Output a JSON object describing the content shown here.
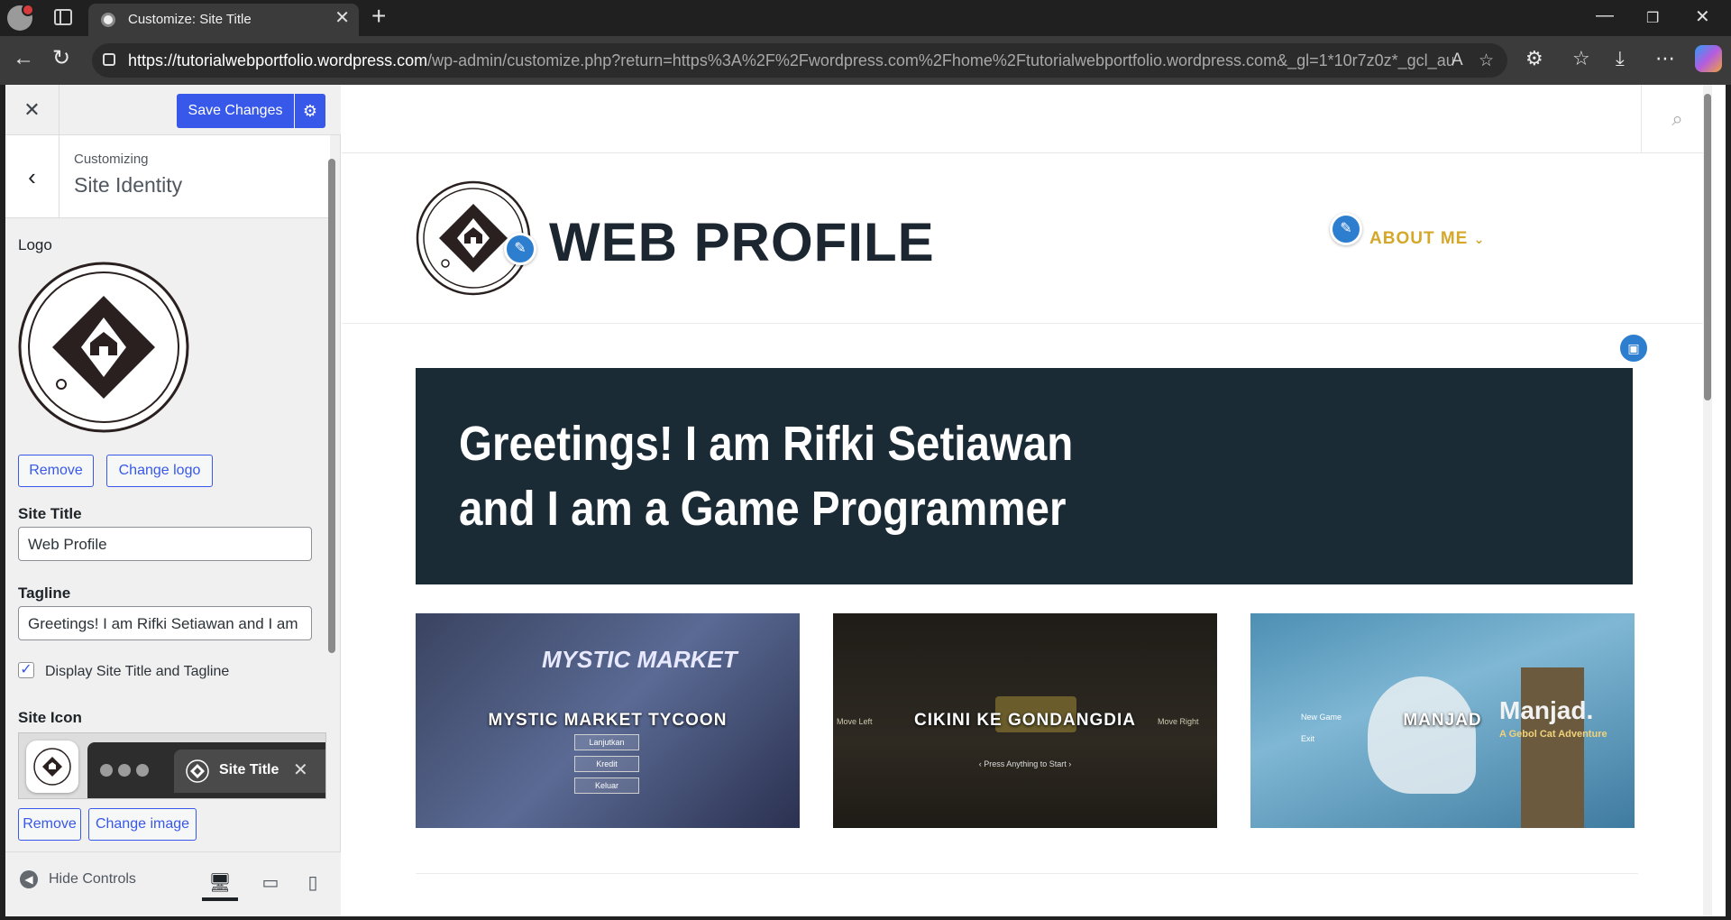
{
  "browser": {
    "tab_title": "Customize: Site Title",
    "url_host": "https://tutorialwebportfolio.wordpress.com",
    "url_rest": "/wp-admin/customize.php?return=https%3A%2F%2Fwordpress.com%2Fhome%2Ftutorialwebportfolio.wordpress.com&_gl=1*10r7z0z*_gcl_au...",
    "accent": "#3858e9"
  },
  "customizer": {
    "save_label": "Save Changes",
    "crumb": "Customizing",
    "section_title": "Site Identity",
    "logo_label": "Logo",
    "remove_label": "Remove",
    "change_logo_label": "Change logo",
    "site_title_label": "Site Title",
    "site_title_value": "Web Profile",
    "tagline_label": "Tagline",
    "tagline_value": "Greetings! I am Rifki Setiawan and I am",
    "display_checkbox_label": "Display Site Title and Tagline",
    "display_checked": true,
    "site_icon_label": "Site Icon",
    "icon_preview_title": "Site Title",
    "remove_icon_label": "Remove",
    "change_image_label": "Change image",
    "hide_controls_label": "Hide Controls"
  },
  "site": {
    "name": "WEB PROFILE",
    "menu_item": "ABOUT ME",
    "hero_line1": "Greetings! I am Rifki Setiawan",
    "hero_line2": "and I am a Game Programmer",
    "cards": [
      {
        "title": "MYSTIC MARKET TYCOON",
        "art_title": "MYSTIC MARKET",
        "buttons": [
          "Lanjutkan",
          "Kredit",
          "Keluar"
        ]
      },
      {
        "title": "CIKINI KE GONDANGDIA",
        "left": "Move Left",
        "right": "Move Right",
        "sub": "‹ Press Anything to Start ›"
      },
      {
        "title": "MANJAD",
        "art_title": "Manjad.",
        "art_sub": "A Gebol Cat Adventure",
        "menu": [
          "New Game",
          "Exit"
        ]
      }
    ],
    "brand_dark": "#1b2b36",
    "menu_color": "#d4a82a"
  }
}
